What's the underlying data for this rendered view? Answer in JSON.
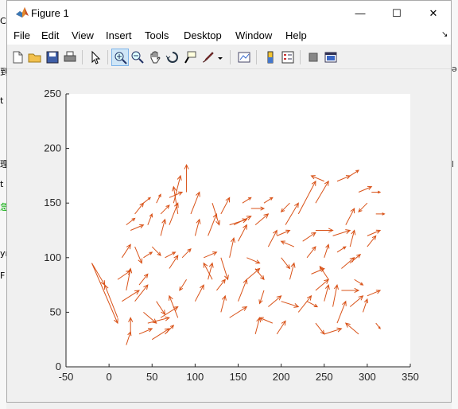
{
  "window": {
    "title": "Figure 1",
    "minimize": "—",
    "maximize": "☐",
    "close": "✕"
  },
  "background_left": [
    "C",
    "到",
    "t",
    "理",
    "t",
    "急",
    "yı",
    "F"
  ],
  "background_right": [
    "ə",
    "l"
  ],
  "menu": [
    "File",
    "Edit",
    "View",
    "Insert",
    "Tools",
    "Desktop",
    "Window",
    "Help"
  ],
  "toolbar_icons": [
    "new-figure-icon",
    "open-icon",
    "save-icon",
    "print-icon",
    "select-arrow-icon",
    "zoom-in-icon",
    "zoom-out-icon",
    "pan-icon",
    "rotate-3d-icon",
    "data-cursor-icon",
    "brush-icon",
    "brush-dropdown-icon",
    "link-plot-icon",
    "colorbar-icon",
    "legend-icon",
    "hide-plot-tools-icon",
    "show-plot-tools-icon"
  ],
  "colors": {
    "quiver": "#D95319",
    "axes_bg": "#ffffff",
    "figure_bg": "#f0f0f0",
    "axis": "#262626"
  },
  "chart_data": {
    "type": "quiver",
    "title": "",
    "xlabel": "",
    "ylabel": "",
    "xlim": [
      -50,
      350
    ],
    "ylim": [
      0,
      250
    ],
    "xticks": [
      "-50",
      "0",
      "50",
      "100",
      "150",
      "200",
      "250",
      "300",
      "350"
    ],
    "yticks": [
      "0",
      "50",
      "100",
      "150",
      "200",
      "250"
    ],
    "grid": false,
    "arrows": [
      [
        -20,
        95,
        30,
        -55
      ],
      [
        -20,
        95,
        15,
        -20
      ],
      [
        10,
        45,
        -15,
        30
      ],
      [
        20,
        70,
        5,
        20
      ],
      [
        25,
        30,
        0,
        15
      ],
      [
        20,
        20,
        5,
        12
      ],
      [
        30,
        60,
        15,
        15
      ],
      [
        40,
        50,
        15,
        -10
      ],
      [
        45,
        40,
        25,
        5
      ],
      [
        35,
        75,
        10,
        10
      ],
      [
        55,
        60,
        10,
        -12
      ],
      [
        60,
        45,
        20,
        10
      ],
      [
        70,
        90,
        10,
        12
      ],
      [
        80,
        45,
        -10,
        20
      ],
      [
        40,
        100,
        10,
        5
      ],
      [
        30,
        110,
        8,
        -15
      ],
      [
        25,
        125,
        15,
        5
      ],
      [
        60,
        120,
        5,
        15
      ],
      [
        70,
        130,
        10,
        20
      ],
      [
        80,
        140,
        -5,
        25
      ],
      [
        75,
        150,
        8,
        25
      ],
      [
        90,
        160,
        0,
        25
      ],
      [
        95,
        140,
        10,
        20
      ],
      [
        100,
        120,
        5,
        15
      ],
      [
        110,
        100,
        15,
        5
      ],
      [
        120,
        80,
        -10,
        15
      ],
      [
        125,
        70,
        10,
        10
      ],
      [
        130,
        50,
        5,
        15
      ],
      [
        140,
        45,
        20,
        10
      ],
      [
        150,
        60,
        10,
        20
      ],
      [
        160,
        80,
        15,
        10
      ],
      [
        170,
        90,
        10,
        -10
      ],
      [
        180,
        70,
        -5,
        -12
      ],
      [
        185,
        55,
        15,
        10
      ],
      [
        190,
        40,
        -15,
        5
      ],
      [
        195,
        30,
        10,
        12
      ],
      [
        170,
        30,
        5,
        15
      ],
      [
        160,
        100,
        15,
        -5
      ],
      [
        150,
        115,
        10,
        15
      ],
      [
        140,
        130,
        20,
        5
      ],
      [
        130,
        140,
        10,
        15
      ],
      [
        120,
        150,
        8,
        -20
      ],
      [
        115,
        120,
        10,
        20
      ],
      [
        140,
        100,
        5,
        18
      ],
      [
        170,
        130,
        15,
        10
      ],
      [
        185,
        110,
        10,
        15
      ],
      [
        195,
        120,
        15,
        5
      ],
      [
        205,
        130,
        15,
        20
      ],
      [
        210,
        150,
        -10,
        -8
      ],
      [
        220,
        140,
        20,
        30
      ],
      [
        240,
        150,
        15,
        20
      ],
      [
        250,
        170,
        -15,
        5
      ],
      [
        265,
        170,
        15,
        5
      ],
      [
        280,
        175,
        10,
        5
      ],
      [
        290,
        160,
        15,
        5
      ],
      [
        300,
        150,
        -10,
        -8
      ],
      [
        275,
        130,
        10,
        15
      ],
      [
        260,
        120,
        20,
        5
      ],
      [
        280,
        110,
        5,
        15
      ],
      [
        300,
        110,
        10,
        10
      ],
      [
        270,
        90,
        15,
        10
      ],
      [
        255,
        80,
        -10,
        12
      ],
      [
        240,
        70,
        15,
        10
      ],
      [
        230,
        60,
        12,
        -5
      ],
      [
        220,
        50,
        15,
        15
      ],
      [
        240,
        40,
        10,
        -10
      ],
      [
        250,
        30,
        20,
        5
      ],
      [
        265,
        40,
        10,
        20
      ],
      [
        280,
        55,
        15,
        10
      ],
      [
        295,
        50,
        5,
        12
      ],
      [
        300,
        65,
        15,
        5
      ],
      [
        285,
        80,
        10,
        -5
      ],
      [
        260,
        55,
        5,
        20
      ],
      [
        290,
        30,
        -15,
        10
      ],
      [
        310,
        40,
        5,
        -5
      ],
      [
        200,
        60,
        20,
        -5
      ],
      [
        210,
        80,
        5,
        15
      ],
      [
        230,
        100,
        10,
        10
      ],
      [
        215,
        110,
        -15,
        5
      ],
      [
        200,
        100,
        10,
        -10
      ],
      [
        180,
        150,
        10,
        5
      ],
      [
        165,
        145,
        15,
        0
      ],
      [
        155,
        150,
        10,
        5
      ],
      [
        145,
        130,
        20,
        8
      ],
      [
        130,
        100,
        8,
        -20
      ],
      [
        115,
        80,
        5,
        15
      ],
      [
        100,
        60,
        10,
        15
      ],
      [
        90,
        80,
        -8,
        -10
      ],
      [
        85,
        100,
        10,
        8
      ],
      [
        65,
        100,
        12,
        5
      ],
      [
        50,
        110,
        10,
        -8
      ],
      [
        45,
        130,
        5,
        10
      ],
      [
        40,
        150,
        8,
        5
      ],
      [
        30,
        140,
        10,
        10
      ],
      [
        20,
        130,
        10,
        6
      ],
      [
        60,
        140,
        10,
        8
      ],
      [
        70,
        155,
        15,
        5
      ],
      [
        55,
        150,
        5,
        8
      ],
      [
        15,
        100,
        10,
        12
      ],
      [
        10,
        80,
        15,
        8
      ],
      [
        15,
        60,
        20,
        10
      ],
      [
        35,
        30,
        15,
        5
      ],
      [
        50,
        25,
        20,
        10
      ],
      [
        65,
        30,
        10,
        8
      ],
      [
        300,
        120,
        15,
        5
      ],
      [
        310,
        140,
        10,
        0
      ],
      [
        305,
        160,
        10,
        0
      ],
      [
        240,
        125,
        20,
        0
      ],
      [
        225,
        115,
        15,
        8
      ],
      [
        250,
        100,
        5,
        12
      ],
      [
        265,
        105,
        10,
        5
      ],
      [
        280,
        95,
        12,
        8
      ],
      [
        235,
        85,
        15,
        5
      ],
      [
        250,
        60,
        5,
        15
      ],
      [
        270,
        70,
        20,
        0
      ]
    ]
  }
}
